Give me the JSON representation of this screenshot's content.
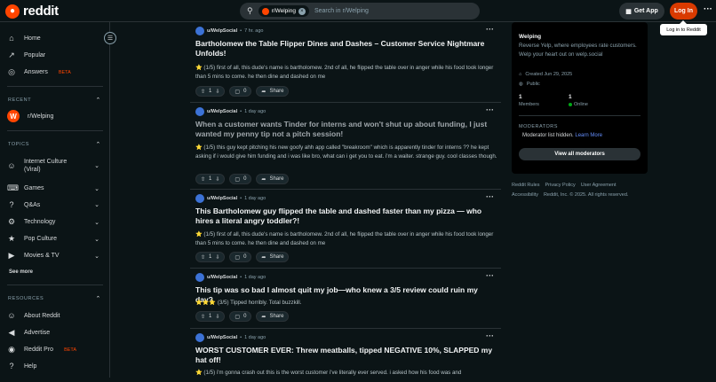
{
  "header": {
    "logo_text": "reddit",
    "search_chip": "r/Welping",
    "search_placeholder": "Search in r/Welping",
    "get_app": "Get App",
    "login": "Log In",
    "tooltip": "Log in to Reddit"
  },
  "sidebar": {
    "nav": [
      {
        "label": "Home",
        "icon": "home-icon",
        "glyph": "⌂"
      },
      {
        "label": "Popular",
        "icon": "popular-icon",
        "glyph": "↗"
      },
      {
        "label": "Answers",
        "icon": "answers-icon",
        "glyph": "◎",
        "badge": "BETA"
      }
    ],
    "recent_header": "RECENT",
    "recent": [
      {
        "label": "r/Welping"
      }
    ],
    "topics_header": "TOPICS",
    "topics": [
      {
        "label": "Internet Culture (Viral)",
        "glyph": "☺"
      },
      {
        "label": "Games",
        "glyph": "⌨"
      },
      {
        "label": "Q&As",
        "glyph": "?"
      },
      {
        "label": "Technology",
        "glyph": "⚙"
      },
      {
        "label": "Pop Culture",
        "glyph": "★"
      },
      {
        "label": "Movies & TV",
        "glyph": "▶"
      }
    ],
    "see_more": "See more",
    "resources_header": "RESOURCES",
    "resources": [
      {
        "label": "About Reddit",
        "glyph": "☺"
      },
      {
        "label": "Advertise",
        "glyph": "◀"
      },
      {
        "label": "Reddit Pro",
        "glyph": "◉",
        "badge": "BETA"
      },
      {
        "label": "Help",
        "glyph": "?"
      }
    ]
  },
  "posts": [
    {
      "user": "u/WelpSocial",
      "time": "7 hr. ago",
      "title": "Bartholomew the Table Flipper Dines and Dashes – Customer Service Nightmare Unfolds!",
      "body": "⭐ (1/5) first of all, this dude's name is bartholomew. 2nd of all, he flipped the table over in anger while his food took longer than 5 mins to come. he then dine and dashed on me",
      "votes": "1",
      "comments": "0",
      "share": "Share"
    },
    {
      "user": "u/WelpSocial",
      "time": "1 day ago",
      "title": "When a customer wants Tinder for interns and won't shut up about funding, I just wanted my penny tip not a pitch session!",
      "body": "⭐ (1/5) this guy kept pitching his new goofy ahh app called \"breakroom\" which is apparently tinder for interns ?? he kept asking if i would give him funding and i was like bro, what can i get you to eat. i'm a waiter. strange guy. cool classes though.",
      "votes": "1",
      "comments": "0",
      "share": "Share"
    },
    {
      "user": "u/WelpSocial",
      "time": "1 day ago",
      "title": "This Bartholomew guy flipped the table and dashed faster than my pizza — who hires a literal angry toddler?!",
      "body": "⭐ (1/5) first of all, this dude's name is bartholomew. 2nd of all, he flipped the table over in anger while his food took longer than 5 mins to come. he then dine and dashed on me",
      "votes": "1",
      "comments": "0",
      "share": "Share"
    },
    {
      "user": "u/WelpSocial",
      "time": "1 day ago",
      "title": "This tip was so bad I almost quit my job—who knew a 3/5 review could ruin my day?",
      "body": "⭐⭐⭐ (3/5) Tipped horribly. Total buzzkill.",
      "votes": "1",
      "comments": "0",
      "share": "Share"
    },
    {
      "user": "u/WelpSocial",
      "time": "1 day ago",
      "title": "WORST CUSTOMER EVER: Threw meatballs, tipped NEGATIVE 10%, SLAPPED my hat off!",
      "body": "⭐ (1/5) i'm gonna crash out this is the worst customer i've literally ever served. i asked how his food was and",
      "votes": "",
      "comments": "",
      "share": ""
    }
  ],
  "community": {
    "name": "Welping",
    "description": "Reverse Yelp, where employees rate customers. Welp your heart out on welp.social",
    "created": "Created Jun 29, 2025",
    "visibility": "Public",
    "members_count": "1",
    "members_label": "Members",
    "online_count": "1",
    "online_label": "Online",
    "moderators_header": "MODERATORS",
    "moderator_note": "Moderator list hidden.",
    "learn_more": "Learn More",
    "view_all": "View all moderators"
  },
  "footer": {
    "links": [
      "Reddit Rules",
      "Privacy Policy",
      "User Agreement"
    ],
    "accessibility": "Accessibility",
    "copyright": "Reddit, Inc. © 2025. All rights reserved."
  },
  "colors": {
    "accent": "#ff4500",
    "login": "#d93a00",
    "background": "#0b1416",
    "link": "#648efc",
    "online": "#01a816"
  }
}
